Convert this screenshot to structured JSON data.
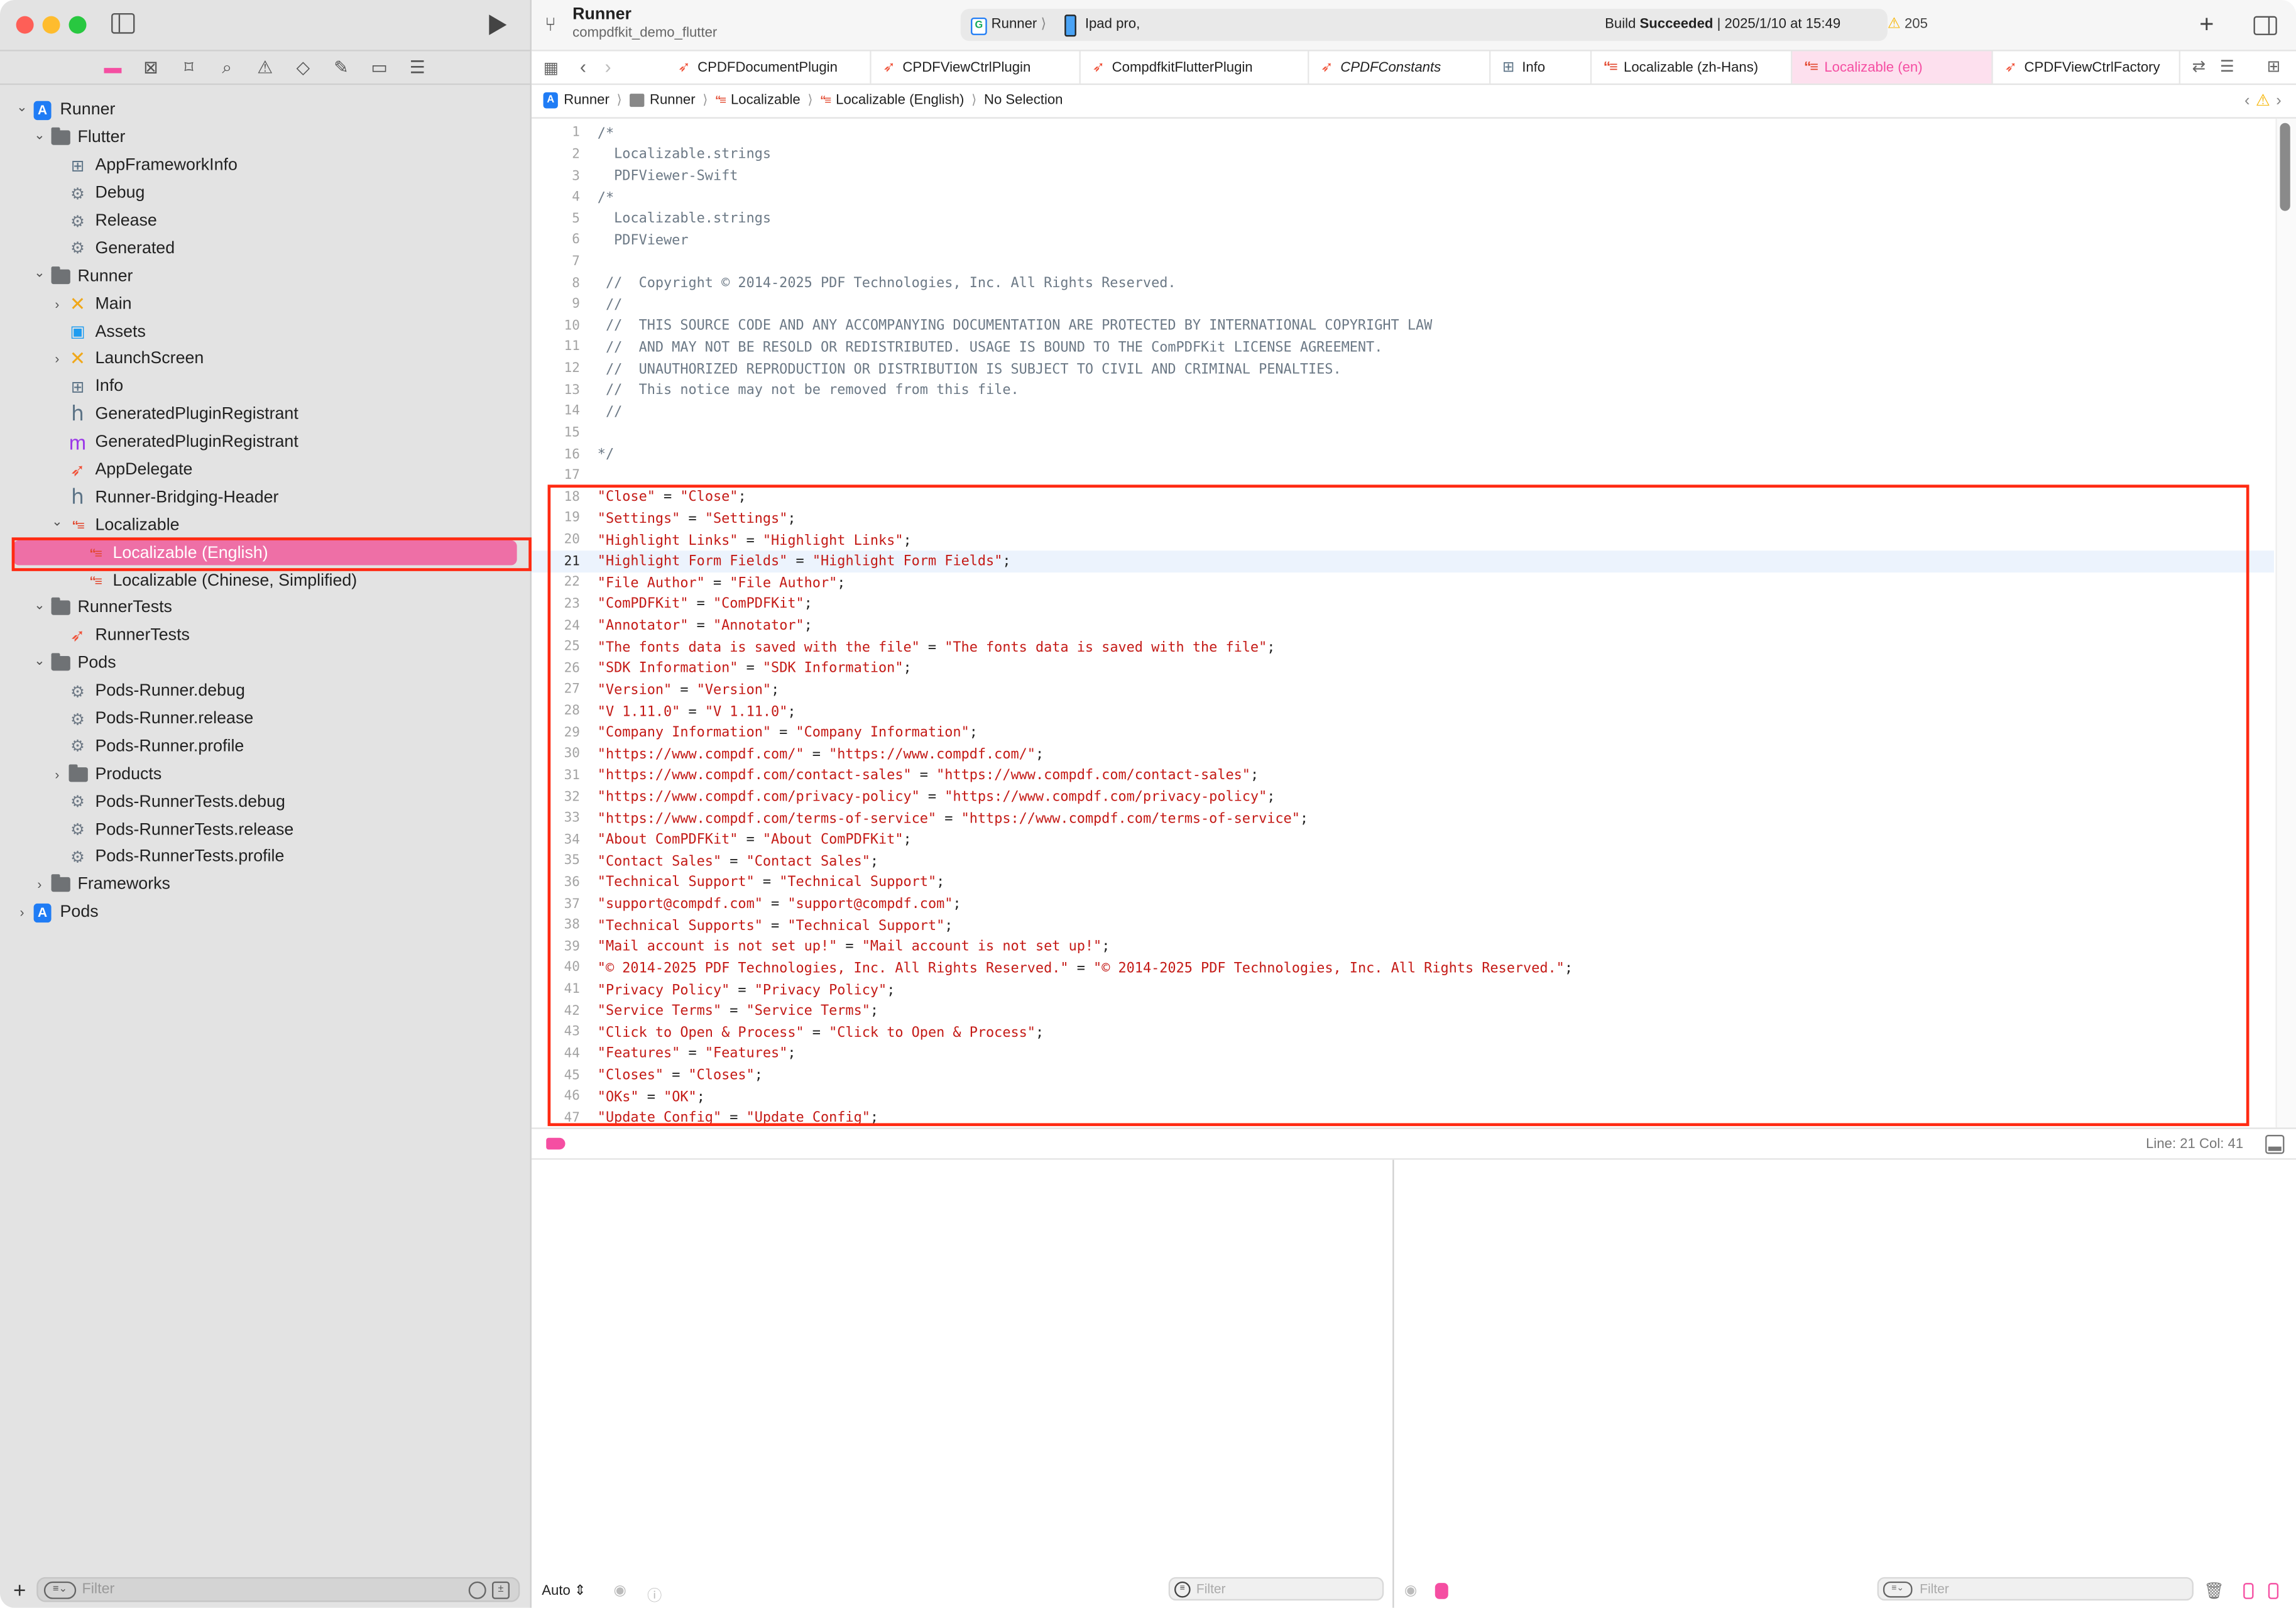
{
  "window": {
    "project_name": "Runner",
    "project_subtitle": "compdfkit_demo_flutter",
    "scheme": "Runner",
    "device": "Ipad pro,",
    "build_status_prefix": "Build ",
    "build_status": "Succeeded",
    "build_time": " | 2025/1/10 at 15:49",
    "warning_count": "205",
    "accent_color": "#f54ea2"
  },
  "navigator_icons": [
    "folder-icon",
    "source-control-icon",
    "bookmark-icon",
    "search-icon",
    "issue-warning-icon",
    "test-diamond-icon",
    "debug-spray-icon",
    "breakpoint-icon",
    "report-icon"
  ],
  "tree": [
    {
      "label": "Runner",
      "depth": 0,
      "icon": "xcode-project-icon",
      "chevron": "down"
    },
    {
      "label": "Flutter",
      "depth": 1,
      "icon": "folder-icon",
      "chevron": "down"
    },
    {
      "label": "AppFrameworkInfo",
      "depth": 2,
      "icon": "plist-icon"
    },
    {
      "label": "Debug",
      "depth": 2,
      "icon": "xcconfig-icon"
    },
    {
      "label": "Release",
      "depth": 2,
      "icon": "xcconfig-icon"
    },
    {
      "label": "Generated",
      "depth": 2,
      "icon": "xcconfig-icon"
    },
    {
      "label": "Runner",
      "depth": 1,
      "icon": "folder-icon",
      "chevron": "down"
    },
    {
      "label": "Main",
      "depth": 2,
      "icon": "storyboard-icon",
      "chevron": "right"
    },
    {
      "label": "Assets",
      "depth": 2,
      "icon": "assets-icon"
    },
    {
      "label": "LaunchScreen",
      "depth": 2,
      "icon": "storyboard-icon",
      "chevron": "right"
    },
    {
      "label": "Info",
      "depth": 2,
      "icon": "plist-icon"
    },
    {
      "label": "GeneratedPluginRegistrant",
      "depth": 2,
      "icon": "header-h-icon"
    },
    {
      "label": "GeneratedPluginRegistrant",
      "depth": 2,
      "icon": "objc-m-icon"
    },
    {
      "label": "AppDelegate",
      "depth": 2,
      "icon": "swift-icon"
    },
    {
      "label": "Runner-Bridging-Header",
      "depth": 2,
      "icon": "header-h-icon"
    },
    {
      "label": "Localizable",
      "depth": 2,
      "icon": "strings-icon",
      "chevron": "down"
    },
    {
      "label": "Localizable (English)",
      "depth": 3,
      "icon": "strings-icon",
      "selected": true
    },
    {
      "label": "Localizable (Chinese, Simplified)",
      "depth": 3,
      "icon": "strings-icon"
    },
    {
      "label": "RunnerTests",
      "depth": 1,
      "icon": "folder-icon",
      "chevron": "down"
    },
    {
      "label": "RunnerTests",
      "depth": 2,
      "icon": "swift-icon"
    },
    {
      "label": "Pods",
      "depth": 1,
      "icon": "folder-icon",
      "chevron": "down"
    },
    {
      "label": "Pods-Runner.debug",
      "depth": 2,
      "icon": "xcconfig-icon"
    },
    {
      "label": "Pods-Runner.release",
      "depth": 2,
      "icon": "xcconfig-icon"
    },
    {
      "label": "Pods-Runner.profile",
      "depth": 2,
      "icon": "xcconfig-icon"
    },
    {
      "label": "Products",
      "depth": 2,
      "icon": "folder-icon",
      "chevron": "right"
    },
    {
      "label": "Pods-RunnerTests.debug",
      "depth": 2,
      "icon": "xcconfig-icon"
    },
    {
      "label": "Pods-RunnerTests.release",
      "depth": 2,
      "icon": "xcconfig-icon"
    },
    {
      "label": "Pods-RunnerTests.profile",
      "depth": 2,
      "icon": "xcconfig-icon"
    },
    {
      "label": "Frameworks",
      "depth": 1,
      "icon": "folder-icon",
      "chevron": "right"
    },
    {
      "label": "Pods",
      "depth": 0,
      "icon": "xcode-project-icon",
      "chevron": "right"
    }
  ],
  "sidebar_filter": {
    "placeholder": "Filter"
  },
  "tabs": [
    {
      "label": "CPDFDocumentPlugin",
      "icon": "swift-icon"
    },
    {
      "label": "CPDFViewCtrlPlugin",
      "icon": "swift-icon"
    },
    {
      "label": "CompdfkitFlutterPlugin",
      "icon": "swift-icon"
    },
    {
      "label": "CPDFConstants",
      "icon": "swift-icon",
      "italic": true
    },
    {
      "label": "Info",
      "icon": "plist-icon"
    },
    {
      "label": "Localizable (zh-Hans)",
      "icon": "strings-icon"
    },
    {
      "label": "Localizable (en)",
      "icon": "strings-icon",
      "active": true
    },
    {
      "label": "CPDFViewCtrlFactory",
      "icon": "swift-icon"
    }
  ],
  "breadcrumb": [
    "Runner",
    "Runner",
    "Localizable",
    "Localizable (English)",
    "No Selection"
  ],
  "editor": {
    "current_line": 21,
    "lines": [
      {
        "n": "1",
        "t": "/*",
        "k": "comment"
      },
      {
        "n": "2",
        "t": "  Localizable.strings",
        "k": "comment"
      },
      {
        "n": "3",
        "t": "  PDFViewer-Swift",
        "k": "comment"
      },
      {
        "n": "4",
        "t": "/*",
        "k": "comment"
      },
      {
        "n": "5",
        "t": "  Localizable.strings",
        "k": "comment"
      },
      {
        "n": "6",
        "t": "  PDFViewer",
        "k": "comment"
      },
      {
        "n": "7",
        "t": "",
        "k": "comment"
      },
      {
        "n": "8",
        "t": " //  Copyright © 2014-2025 PDF Technologies, Inc. All Rights Reserved.",
        "k": "comment"
      },
      {
        "n": "9",
        "t": " //",
        "k": "comment"
      },
      {
        "n": "10",
        "t": " //  THIS SOURCE CODE AND ANY ACCOMPANYING DOCUMENTATION ARE PROTECTED BY INTERNATIONAL COPYRIGHT LAW",
        "k": "comment"
      },
      {
        "n": "11",
        "t": " //  AND MAY NOT BE RESOLD OR REDISTRIBUTED. USAGE IS BOUND TO THE ComPDFKit LICENSE AGREEMENT.",
        "k": "comment"
      },
      {
        "n": "12",
        "t": " //  UNAUTHORIZED REPRODUCTION OR DISTRIBUTION IS SUBJECT TO CIVIL AND CRIMINAL PENALTIES.",
        "k": "comment"
      },
      {
        "n": "13",
        "t": " //  This notice may not be removed from this file.",
        "k": "comment"
      },
      {
        "n": "14",
        "t": " //",
        "k": "comment"
      },
      {
        "n": "15",
        "t": "",
        "k": "comment"
      },
      {
        "n": "16",
        "t": "*/",
        "k": "comment"
      },
      {
        "n": "17",
        "t": "",
        "k": "comment"
      },
      {
        "n": "18",
        "key": "Close",
        "val": "Close"
      },
      {
        "n": "19",
        "key": "Settings",
        "val": "Settings"
      },
      {
        "n": "20",
        "key": "Highlight Links",
        "val": "Highlight Links"
      },
      {
        "n": "21",
        "key": "Highlight Form Fields",
        "val": "Highlight Form Fields"
      },
      {
        "n": "22",
        "key": "File Author",
        "val": "File Author"
      },
      {
        "n": "23",
        "key": "ComPDFKit",
        "val": "ComPDFKit"
      },
      {
        "n": "24",
        "key": "Annotator",
        "val": "Annotator"
      },
      {
        "n": "25",
        "key": "The fonts data is saved with the file",
        "val": "The fonts data is saved with the file"
      },
      {
        "n": "26",
        "key": "SDK Information",
        "val": "SDK Information"
      },
      {
        "n": "27",
        "key": "Version",
        "val": "Version"
      },
      {
        "n": "28",
        "key": "V 1.11.0",
        "val": "V 1.11.0"
      },
      {
        "n": "29",
        "key": "Company Information",
        "val": "Company Information"
      },
      {
        "n": "30",
        "key": "https://www.compdf.com/",
        "val": "https://www.compdf.com/"
      },
      {
        "n": "31",
        "key": "https://www.compdf.com/contact-sales",
        "val": "https://www.compdf.com/contact-sales"
      },
      {
        "n": "32",
        "key": "https://www.compdf.com/privacy-policy",
        "val": "https://www.compdf.com/privacy-policy"
      },
      {
        "n": "33",
        "key": "https://www.compdf.com/terms-of-service",
        "val": "https://www.compdf.com/terms-of-service"
      },
      {
        "n": "34",
        "key": "About ComPDFKit",
        "val": "About ComPDFKit"
      },
      {
        "n": "35",
        "key": "Contact Sales",
        "val": "Contact Sales"
      },
      {
        "n": "36",
        "key": "Technical Support",
        "val": "Technical Support"
      },
      {
        "n": "37",
        "key": "support@compdf.com",
        "val": "support@compdf.com"
      },
      {
        "n": "38",
        "key": "Technical Supports",
        "val": "Technical Support"
      },
      {
        "n": "39",
        "key": "Mail account is not set up!",
        "val": "Mail account is not set up!"
      },
      {
        "n": "40",
        "key": "© 2014-2025 PDF Technologies, Inc. All Rights Reserved.",
        "val": "© 2014-2025 PDF Technologies, Inc. All Rights Reserved."
      },
      {
        "n": "41",
        "key": "Privacy Policy",
        "val": "Privacy Policy"
      },
      {
        "n": "42",
        "key": "Service Terms",
        "val": "Service Terms"
      },
      {
        "n": "43",
        "key": "Click to Open & Process",
        "val": "Click to Open & Process"
      },
      {
        "n": "44",
        "key": "Features",
        "val": "Features"
      },
      {
        "n": "45",
        "key": "Closes",
        "val": "Closes"
      },
      {
        "n": "46",
        "key": "OKs",
        "val": "OK"
      },
      {
        "n": "47",
        "key": "Update Config",
        "val": "Update Config"
      }
    ]
  },
  "status": {
    "position": "Line: 21  Col: 41"
  },
  "debug": {
    "variables_mode": "Auto ⇕",
    "variables_filter_placeholder": "Filter",
    "console_filter_placeholder": "Filter"
  },
  "glyphs": {
    "chev_down": "⌄",
    "chev_right": "›",
    "swift": "➶",
    "gears": "⚙",
    "plist": "⊞",
    "strings": "“≡",
    "xib": "✕",
    "h": "h",
    "m": "m",
    "assets": "▣",
    "proj": "A",
    "back": "‹",
    "fwd": "›",
    "grid": "▦",
    "branch": "⑂",
    "warn": "⚠",
    "plus": "+",
    "eye": "◉",
    "info": "ⓘ",
    "trash": "🗑",
    "sep": "⟩"
  }
}
